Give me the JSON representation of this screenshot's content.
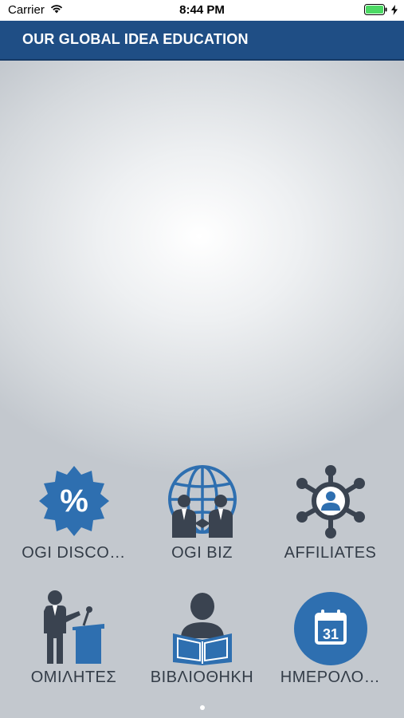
{
  "status_bar": {
    "carrier": "Carrier",
    "time": "8:44 PM"
  },
  "header": {
    "title": "OUR GLOBAL IDEA EDUCATION"
  },
  "tiles": [
    {
      "label": "OGI DISCO…",
      "icon": "discount-badge-icon"
    },
    {
      "label": "OGI BIZ",
      "icon": "globe-business-icon"
    },
    {
      "label": "AFFILIATES",
      "icon": "network-people-icon"
    },
    {
      "label": "ΟΜΙΛΗΤΕΣ",
      "icon": "speaker-podium-icon"
    },
    {
      "label": "ΒΙΒΛΙΟΘΗΚΗ",
      "icon": "reader-book-icon"
    },
    {
      "label": "ΗΜΕΡΟΛΟ…",
      "icon": "calendar-icon",
      "calendar_day": "31"
    }
  ],
  "pager": {
    "pages": 1,
    "current": 1
  },
  "colors": {
    "header_bg": "#1f4e85",
    "icon_blue": "#2e6fb0",
    "icon_dark": "#3a4350",
    "label": "#333c47",
    "battery": "#4cd964"
  }
}
